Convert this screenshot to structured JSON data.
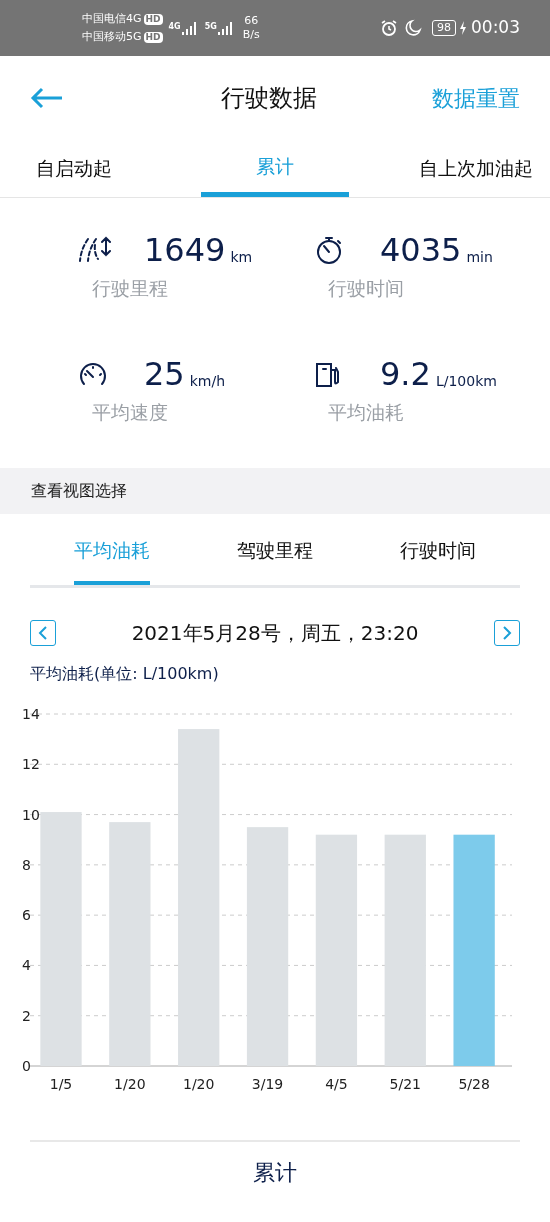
{
  "status_bar": {
    "carriers": [
      {
        "name": "中国电信4G",
        "badge": "HD"
      },
      {
        "name": "中国移动5G",
        "badge": "HD"
      }
    ],
    "network_labels": [
      "4G",
      "5G"
    ],
    "speed_value": "66",
    "speed_unit": "B/s",
    "battery": "98",
    "time": "00:03"
  },
  "header": {
    "title": "行驶数据",
    "action": "数据重置"
  },
  "tabs": [
    {
      "label": "自启动起",
      "selected": false
    },
    {
      "label": "累计",
      "selected": true
    },
    {
      "label": "自上次加油起",
      "selected": false
    }
  ],
  "stats": [
    {
      "kind": "distance",
      "value": "1649",
      "unit": "km",
      "label": "行驶里程"
    },
    {
      "kind": "time",
      "value": "4035",
      "unit": "min",
      "label": "行驶时间"
    },
    {
      "kind": "speed",
      "value": "25",
      "unit": "km/h",
      "label": "平均速度"
    },
    {
      "kind": "fuel",
      "value": "9.2",
      "unit": "L/100km",
      "label": "平均油耗"
    }
  ],
  "section_title": "查看视图选择",
  "view_tabs": [
    {
      "label": "平均油耗",
      "selected": true
    },
    {
      "label": "驾驶里程",
      "selected": false
    },
    {
      "label": "行驶时间",
      "selected": false
    }
  ],
  "date": "2021年5月28号，周五，23:20",
  "chart_title": "平均油耗(单位: L/100km)",
  "chart_data": {
    "type": "bar",
    "stacked": true,
    "categories": [
      "1/5",
      "1/20",
      "1/20",
      "3/19",
      "4/5",
      "5/21",
      "5/28"
    ],
    "grid": true,
    "series": [
      {
        "color": "#dde1e4",
        "values": [
          10.1,
          9.7,
          13.4,
          9.5,
          9.2,
          9.2,
          null
        ]
      },
      {
        "color": "#7dcbeb",
        "values": [
          null,
          null,
          null,
          null,
          null,
          null,
          9.2
        ]
      }
    ],
    "ylim": [
      0,
      14
    ],
    "yticks": [
      0,
      2,
      4,
      6,
      8,
      10,
      12,
      14
    ]
  },
  "footer_title": "累计"
}
